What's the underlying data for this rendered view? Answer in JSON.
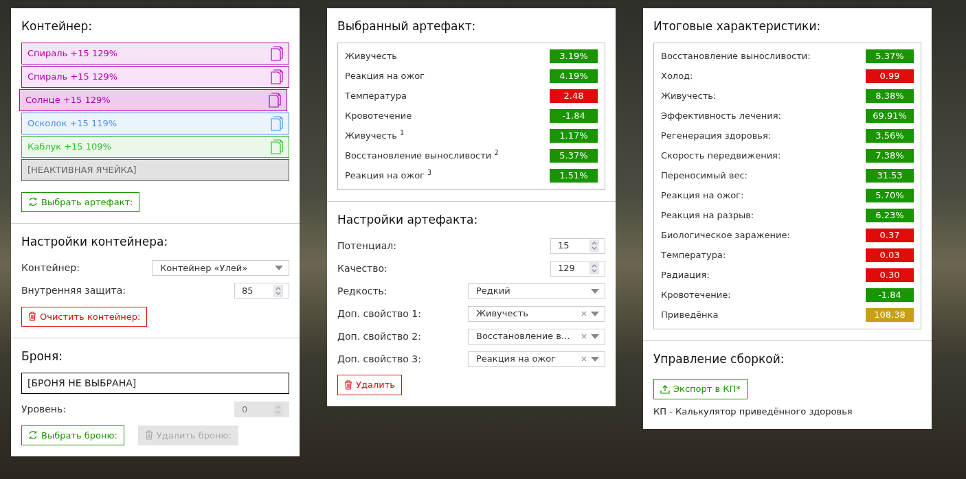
{
  "container_panel": {
    "title": "Контейнер:",
    "slots": [
      {
        "kind": "artifact",
        "label": "Спираль +15 129%",
        "color": "#b000b0",
        "selected": false
      },
      {
        "kind": "artifact",
        "label": "Спираль +15 129%",
        "color": "#b000b0",
        "selected": false
      },
      {
        "kind": "artifact",
        "label": "Солнце +15 129%",
        "color": "#b000b0",
        "selected": true
      },
      {
        "kind": "artifact",
        "label": "Осколок +15 119%",
        "color": "#4a90e2",
        "selected": false
      },
      {
        "kind": "artifact",
        "label": "Каблук +15 109%",
        "color": "#33bb33",
        "selected": false
      },
      {
        "kind": "inactive",
        "label": "[НЕАКТИВНАЯ ЯЧЕЙКА]",
        "selected": false
      }
    ],
    "button": {
      "kind": "select",
      "label": "Выбрать артефакт:",
      "disabled": false
    }
  },
  "container_settings": {
    "title": "Настройки контейнера:",
    "fields": [
      {
        "kind": "select",
        "label": "Контейнер:",
        "value": "Контейнер «Улей»",
        "clearable": false
      },
      {
        "kind": "number",
        "label": "Внутренняя защита:",
        "value": "85",
        "disabled": false
      }
    ],
    "button": {
      "kind": "delete",
      "label": "Очистить контейнер:",
      "disabled": false
    }
  },
  "armor": {
    "title": "Броня:",
    "selection": "[БРОНЯ НЕ ВЫБРАНА]",
    "fields": [
      {
        "kind": "number",
        "label": "Уровень:",
        "value": "0",
        "disabled": true
      }
    ],
    "buttons": [
      {
        "kind": "select",
        "label": "Выбрать броню:",
        "disabled": false
      },
      {
        "kind": "delete",
        "label": "Удалить броню:",
        "disabled": true
      }
    ]
  },
  "selected_artifact": {
    "title": "Выбранный артефакт:",
    "stats": [
      {
        "label": "Живучесть",
        "value": "3.19%",
        "color": "#1a9400"
      },
      {
        "label": "Реакция на ожог",
        "value": "4.19%",
        "color": "#1a9400"
      },
      {
        "label": "Температура",
        "value": "2.48",
        "color": "#e00b0b"
      },
      {
        "label": "Кровотечение",
        "value": "-1.84",
        "color": "#1a9400"
      },
      {
        "label": "Живучесть $^{1}$",
        "value": "1.17%",
        "color": "#1a9400"
      },
      {
        "label": "Восстановление выносливости $^{2}$",
        "value": "5.37%",
        "color": "#1a9400"
      },
      {
        "label": "Реакция на ожог $^{3}$",
        "value": "1.51%",
        "color": "#1a9400"
      }
    ]
  },
  "artifact_settings": {
    "title": "Настройки артефакта:",
    "fields": [
      {
        "kind": "number",
        "label": "Потенциал:",
        "value": "15",
        "disabled": false
      },
      {
        "kind": "number",
        "label": "Качество:",
        "value": "129",
        "disabled": false
      },
      {
        "kind": "select",
        "label": "Редкость:",
        "value": "Редкий",
        "clearable": false
      },
      {
        "kind": "select",
        "label": "Доп. свойство 1:",
        "value": "Живучесть",
        "clearable": true
      },
      {
        "kind": "select",
        "label": "Доп. свойство 2:",
        "value": "Восстановление в...",
        "clearable": true
      },
      {
        "kind": "select",
        "label": "Доп. свойство 3:",
        "value": "Реакция на ожог",
        "clearable": true
      }
    ],
    "button": {
      "kind": "delete",
      "label": "Удалить",
      "disabled": false
    }
  },
  "total_stats": {
    "title": "Итоговые характеристики:",
    "stats": [
      {
        "label": "Восстановление выносливости:",
        "value": "5.37%",
        "color": "#1a9400"
      },
      {
        "label": "Холод:",
        "value": "0.99",
        "color": "#e00b0b"
      },
      {
        "label": "Живучесть:",
        "value": "8.38%",
        "color": "#1a9400"
      },
      {
        "label": "Эффективность лечения:",
        "value": "69.91%",
        "color": "#1a9400"
      },
      {
        "label": "Регенерация здоровья:",
        "value": "3.56%",
        "color": "#1a9400"
      },
      {
        "label": "Скорость передвижения:",
        "value": "7.38%",
        "color": "#1a9400"
      },
      {
        "label": "Переносимый вес:",
        "value": "31.53",
        "color": "#1a9400"
      },
      {
        "label": "Реакция на ожог:",
        "value": "5.70%",
        "color": "#1a9400"
      },
      {
        "label": "Реакция на разрыв:",
        "value": "6.23%",
        "color": "#1a9400"
      },
      {
        "label": "Биологическое заражение:",
        "value": "0.37",
        "color": "#e00b0b"
      },
      {
        "label": "Температура:",
        "value": "0.03",
        "color": "#e00b0b"
      },
      {
        "label": "Радиация:",
        "value": "0.30",
        "color": "#e00b0b"
      },
      {
        "label": "Кровотечение:",
        "value": "-1.84",
        "color": "#1a9400"
      },
      {
        "label": "Приведёнка",
        "value": "108.38",
        "color": "#c8a016"
      }
    ]
  },
  "build_management": {
    "title": "Управление сборкой:",
    "button": {
      "kind": "export",
      "label": "Экспорт в КП*",
      "disabled": false
    },
    "note": "КП - Калькулятор приведённого здоровья"
  }
}
